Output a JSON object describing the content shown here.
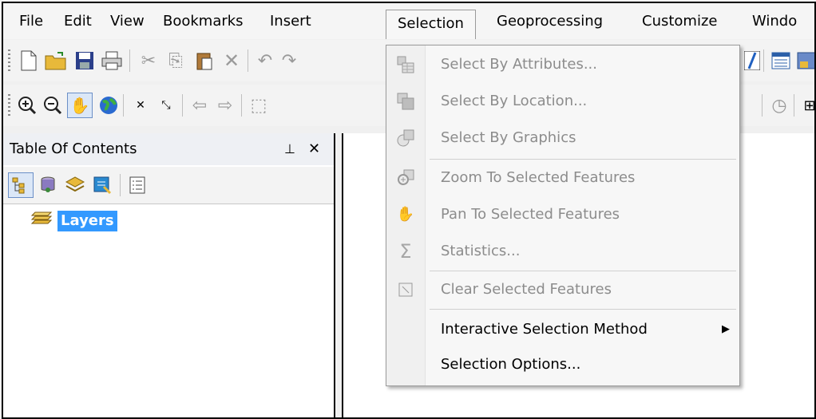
{
  "menubar": {
    "items": [
      "File",
      "Edit",
      "View",
      "Bookmarks",
      "Insert",
      "Selection",
      "Geoprocessing",
      "Customize",
      "Windo"
    ]
  },
  "toc": {
    "title": "Table Of Contents",
    "layers_label": "Layers"
  },
  "selection_menu": {
    "items": [
      {
        "label": "Select By Attributes...",
        "enabled": false,
        "icon": "select-by-attributes-icon"
      },
      {
        "label": "Select By Location...",
        "enabled": false,
        "icon": "select-by-location-icon"
      },
      {
        "label": "Select By Graphics",
        "enabled": false,
        "icon": "select-by-graphics-icon"
      },
      {
        "label": "Zoom To Selected Features",
        "enabled": false,
        "icon": "zoom-to-selected-icon"
      },
      {
        "label": "Pan To Selected Features",
        "enabled": false,
        "icon": "pan-to-selected-icon"
      },
      {
        "label": "Statistics...",
        "enabled": false,
        "icon": "sigma-icon"
      },
      {
        "label": "Clear Selected Features",
        "enabled": false,
        "icon": "clear-selection-icon"
      },
      {
        "label": "Interactive Selection Method",
        "enabled": true,
        "icon": "",
        "submenu": true
      },
      {
        "label": "Selection Options...",
        "enabled": true,
        "icon": ""
      }
    ]
  },
  "colors": {
    "highlight": "#3399ff",
    "disabled_text": "#8c8c8c"
  }
}
